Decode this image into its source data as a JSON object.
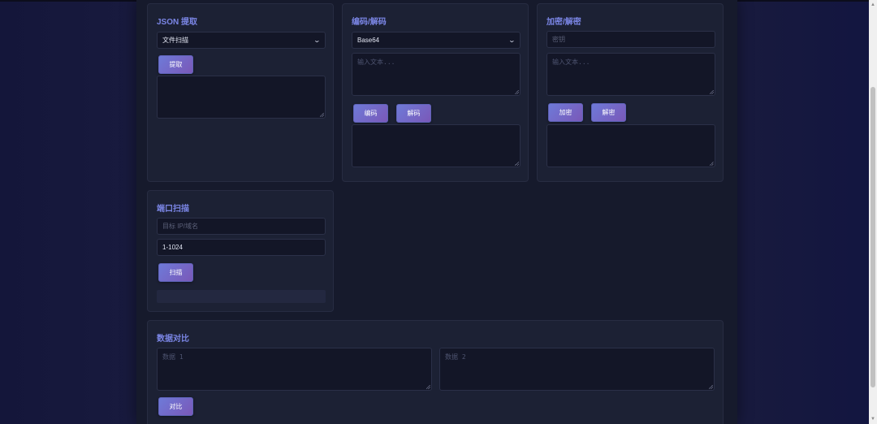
{
  "json_extract": {
    "title": "JSON 提取",
    "select_value": "文件扫描",
    "extract_button": "提取",
    "output": ""
  },
  "encode": {
    "title": "编码/解码",
    "select_value": "Base64",
    "input_placeholder": "输入文本...",
    "encode_button": "编码",
    "decode_button": "解码",
    "output": ""
  },
  "crypto": {
    "title": "加密/解密",
    "key_placeholder": "密钥",
    "input_placeholder": "输入文本...",
    "encrypt_button": "加密",
    "decrypt_button": "解密",
    "output": ""
  },
  "port_scan": {
    "title": "端口扫描",
    "target_placeholder": "目标 IP/域名",
    "port_range": "1-1024",
    "scan_button": "扫描",
    "progress": 0
  },
  "compare": {
    "title": "数据对比",
    "data1_placeholder": "数据 1",
    "data2_placeholder": "数据 2",
    "compare_button": "对比"
  },
  "colors": {
    "accent": "#7b86e6",
    "button_start": "#6e7ad8",
    "button_end": "#7a58b8",
    "card_bg": "#1c2134",
    "field_bg": "#131627"
  }
}
